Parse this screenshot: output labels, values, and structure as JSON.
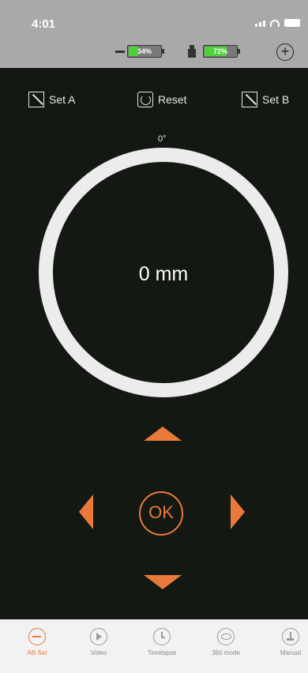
{
  "status_bar": {
    "time": "4:01"
  },
  "device_bar": {
    "battery_1": {
      "label": "34%",
      "level": 0.34
    },
    "battery_2": {
      "label": "72%",
      "level": 0.72
    },
    "add_icon": "plus-circle-icon"
  },
  "actions": {
    "set_a": "Set A",
    "reset": "Reset",
    "set_b": "Set B"
  },
  "dial": {
    "angle": "0°",
    "distance": "0 mm"
  },
  "controls": {
    "ok": "OK"
  },
  "tabs": [
    {
      "label": "AB Set",
      "icon": "ab-set-icon",
      "active": true
    },
    {
      "label": "Video",
      "icon": "play-icon",
      "active": false
    },
    {
      "label": "Timelapse",
      "icon": "clock-icon",
      "active": false
    },
    {
      "label": "360 mode",
      "icon": "rotation-icon",
      "active": false
    },
    {
      "label": "Manual",
      "icon": "joystick-icon",
      "active": false
    }
  ],
  "colors": {
    "accent": "#e97a3a",
    "background": "#141813",
    "header": "#a9a9a9",
    "battery_fill": "#4cd137"
  }
}
